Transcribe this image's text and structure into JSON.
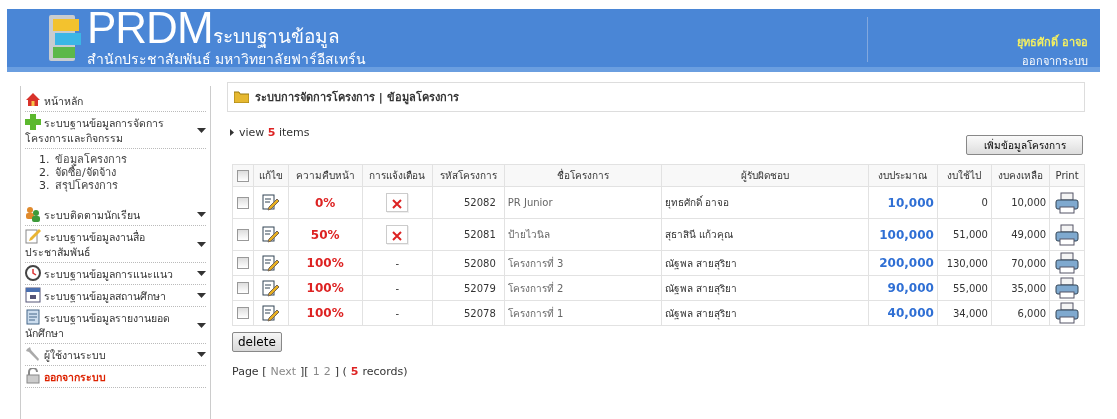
{
  "header": {
    "logo": "PRDM",
    "system_name": "ระบบฐานข้อมูล",
    "subtitle": "สำนักประชาสัมพันธ์  มหาวิทยาลัยฟาร์อีสเทร์น",
    "user_name": "ยุทธศักดิ์ อาจอ",
    "logout": "ออกจากระบบ"
  },
  "sidebar": {
    "items": [
      {
        "kind": "home",
        "label": "หน้าหลัก",
        "dropdown": false
      },
      {
        "kind": "plus",
        "label": "ระบบฐานข้อมูลการจัดการโครงการและกิจกรรม",
        "dropdown": true,
        "children": [
          {
            "number": "1.",
            "label": "ข้อมูลโครงการ"
          },
          {
            "number": "2.",
            "label": "จัดซื้อ/จัดจ้าง"
          },
          {
            "number": "3.",
            "label": "สรุปโครงการ"
          }
        ]
      },
      {
        "kind": "people",
        "label": "ระบบติดตามนักเรียน",
        "dropdown": true
      },
      {
        "kind": "note",
        "label": "ระบบฐานข้อมูลงานสื่อประชาสัมพันธ์",
        "dropdown": true
      },
      {
        "kind": "clock",
        "label": "ระบบฐานข้อมูลการแนะแนว",
        "dropdown": true
      },
      {
        "kind": "calendar",
        "label": "ระบบฐานข้อมูลสถานศึกษา",
        "dropdown": true
      },
      {
        "kind": "report",
        "label": "ระบบฐานข้อมูลรายงานยอดนักศึกษา",
        "dropdown": true
      },
      {
        "kind": "wrench",
        "label": "ผู้ใช้งานระบบ",
        "dropdown": true
      },
      {
        "kind": "lock",
        "label": "ออกจากระบบ",
        "dropdown": false
      }
    ]
  },
  "content": {
    "breadcrumb": "ระบบการจัดการโครงการ | ข้อมูลโครงการ",
    "view_count": "view **5** items",
    "add_button": "เพิ่มข้อมูลโครงการ",
    "table": {
      "select_all": {
        "checked": false
      },
      "columns": [
        "แก้ไข",
        "ความคืบหน้า",
        "การแจ้งเตือน",
        "รหัสโครงการ",
        "ชื่อโครงการ",
        "ผู้รับผิดชอบ",
        "งบประมาณ",
        "งบใช้ไป",
        "งบคงเหลือ",
        "Print"
      ],
      "rows": [
        {
          "checked": false,
          "progress": "0%",
          "notice": {
            "kind": "image"
          },
          "code": "52082",
          "name": "PR Junior",
          "owner": "ยุทธศักดิ์ อาจอ",
          "budget": "10,000",
          "spent": "0",
          "remaining": "10,000"
        },
        {
          "checked": false,
          "progress": "50%",
          "notice": {
            "kind": "image"
          },
          "code": "52081",
          "name": "ป้ายไวนิล",
          "owner": "สุธาสินี แก้วคุณ",
          "budget": "100,000",
          "spent": "51,000",
          "remaining": "49,000"
        },
        {
          "checked": false,
          "progress": "100%",
          "notice": {
            "kind": "text",
            "text": "-"
          },
          "code": "52080",
          "name": "โครงการที่ 3",
          "owner": "ณัฐพล สายสุริยา",
          "budget": "200,000",
          "spent": "130,000",
          "remaining": "70,000"
        },
        {
          "checked": false,
          "progress": "100%",
          "notice": {
            "kind": "text",
            "text": "-"
          },
          "code": "52079",
          "name": "โครงการที่ 2",
          "owner": "ณัฐพล สายสุริยา",
          "budget": "90,000",
          "spent": "55,000",
          "remaining": "35,000"
        },
        {
          "checked": false,
          "progress": "100%",
          "notice": {
            "kind": "text",
            "text": "-"
          },
          "code": "52078",
          "name": "โครงการที่ 1",
          "owner": "ณัฐพล สายสุริยา",
          "budget": "40,000",
          "spent": "34,000",
          "remaining": "6,000"
        }
      ]
    },
    "delete_button": "delete",
    "pager": {
      "label": "Page [",
      "next": "Next",
      "sep": "][",
      "pages": [
        "1",
        "2"
      ],
      "close": "] (",
      "records_count": "5",
      "records": "records)"
    }
  }
}
